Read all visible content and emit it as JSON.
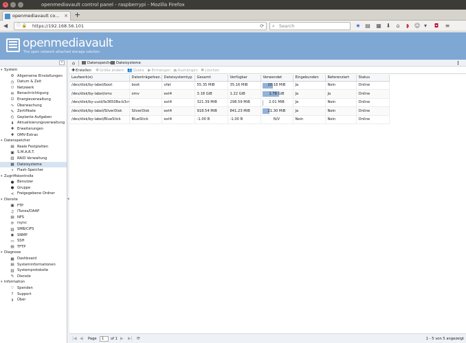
{
  "window": {
    "title": "openmediavault control panel - raspberrypi - Mozilla Firefox"
  },
  "tab": {
    "label": "openmediavault co...",
    "close": "×",
    "new_tab": "+"
  },
  "nav": {
    "url": "https://192.168.56.101",
    "search_placeholder": "Search"
  },
  "header": {
    "logo_text": "openmediavault",
    "tagline": "The open network attached storage solution"
  },
  "sidebar": {
    "sections": [
      {
        "label": "System",
        "items": [
          {
            "label": "Allgemeine Einstellungen",
            "icon": "⚙"
          },
          {
            "label": "Datum & Zeit",
            "icon": "◷"
          },
          {
            "label": "Netzwerk",
            "icon": "⚇"
          },
          {
            "label": "Benachrichtigung",
            "icon": "✉"
          },
          {
            "label": "Energieverwaltung",
            "icon": "⏻"
          },
          {
            "label": "Überwachung",
            "icon": "∿"
          },
          {
            "label": "Zertifikate",
            "icon": "✎"
          },
          {
            "label": "Geplante Aufgaben",
            "icon": "◴"
          },
          {
            "label": "Aktualisierungsverwaltung",
            "icon": "⬇"
          },
          {
            "label": "Erweiterungen",
            "icon": "✚"
          },
          {
            "label": "OMV-Extras",
            "icon": "✚"
          }
        ]
      },
      {
        "label": "Datenspeicher",
        "items": [
          {
            "label": "Reale Festplatten",
            "icon": "▤"
          },
          {
            "label": "S.M.A.R.T.",
            "icon": "▣"
          },
          {
            "label": "RAID Verwaltung",
            "icon": "▥"
          },
          {
            "label": "Dateisysteme",
            "icon": "▦"
          },
          {
            "label": "Flash-Speicher",
            "icon": "⚡"
          }
        ]
      },
      {
        "label": "Zugriffskontrolle",
        "items": [
          {
            "label": "Benutzer",
            "icon": "●"
          },
          {
            "label": "Gruppe",
            "icon": "●"
          },
          {
            "label": "Freigegebene Ordner",
            "icon": "≺"
          }
        ]
      },
      {
        "label": "Dienste",
        "items": [
          {
            "label": "FTP",
            "icon": "▣"
          },
          {
            "label": "iTunes/DAAP",
            "icon": "♫"
          },
          {
            "label": "NFS",
            "icon": "▤"
          },
          {
            "label": "rsync",
            "icon": "⟳"
          },
          {
            "label": "SMB/CIFS",
            "icon": "▥"
          },
          {
            "label": "SNMP",
            "icon": "◉"
          },
          {
            "label": "SSH",
            "icon": "▭"
          },
          {
            "label": "TFTP",
            "icon": "▤"
          }
        ]
      },
      {
        "label": "Diagnose",
        "items": [
          {
            "label": "Dashboard",
            "icon": "▦"
          },
          {
            "label": "Systeminformationen",
            "icon": "▤"
          },
          {
            "label": "Systemprotokolle",
            "icon": "▥"
          },
          {
            "label": "Dienste",
            "icon": "✎"
          }
        ]
      },
      {
        "label": "Information",
        "items": [
          {
            "label": "Spenden",
            "icon": "♡"
          },
          {
            "label": "Support",
            "icon": "?"
          },
          {
            "label": "Über",
            "icon": "ℹ"
          }
        ]
      }
    ],
    "selected": "Dateisysteme"
  },
  "breadcrumb": {
    "level1": "Datenspeicher",
    "level2": "Dateisysteme"
  },
  "toolbar": {
    "create": "Erstellen",
    "resize": "Größe ändern",
    "quota": "Quota",
    "mount": "Einhängen",
    "unmount": "Aushängen",
    "delete": "Löschen"
  },
  "table": {
    "columns": [
      "Laufwerk(e)",
      "Datenträgerbez...",
      "Dateisystemtyp",
      "Gesamt",
      "Verfügbar",
      "Verwendet",
      "Eingebunden",
      "Referenziert",
      "Status"
    ],
    "rows": [
      {
        "drive": "/dev/disk/by-label/boot",
        "label": "boot",
        "type": "vfat",
        "total": "55.35 MiB",
        "available": "35.16 MiB",
        "used": "20.18 MiB",
        "used_pct": 36,
        "mounted": "Ja",
        "referenced": "Nein",
        "status": "Online"
      },
      {
        "drive": "/dev/disk/by-label/omv",
        "label": "omv",
        "type": "ext4",
        "total": "3.18 GiB",
        "available": "1.22 GiB",
        "used": "1.78 GiB",
        "used_pct": 56,
        "mounted": "Ja",
        "referenced": "Ja",
        "status": "Online"
      },
      {
        "drive": "/dev/disk/by-uuid/fa36508a-b3c4...",
        "label": "",
        "type": "ext4",
        "total": "321.39 MiB",
        "available": "298.59 MiB",
        "used": "2.01 MiB",
        "used_pct": 1,
        "mounted": "Ja",
        "referenced": "Nein",
        "status": "Online"
      },
      {
        "drive": "/dev/disk/by-label/SilverDisk",
        "label": "SilverDisk",
        "type": "ext4",
        "total": "918.54 MiB",
        "available": "841.23 MiB",
        "used": "21.30 MiB",
        "used_pct": 25,
        "mounted": "Ja",
        "referenced": "Nein",
        "status": "Online"
      },
      {
        "drive": "/dev/disk/by-label/BlueStick",
        "label": "BlueStick",
        "type": "ext4",
        "total": "-1.00 B",
        "available": "-1.00 B",
        "used": "N/V",
        "used_pct": 0,
        "mounted": "Nein",
        "referenced": "Nein",
        "status": "Online"
      }
    ]
  },
  "pager": {
    "page_label": "Page",
    "page_value": "1",
    "of_label": "of 1",
    "info": "1 - 5 von 5 angezeigt"
  },
  "colors": {
    "header_bg": "#7fa7d3",
    "bar_fill": "#92b2d8",
    "selected_bg": "#d5e3f2"
  }
}
